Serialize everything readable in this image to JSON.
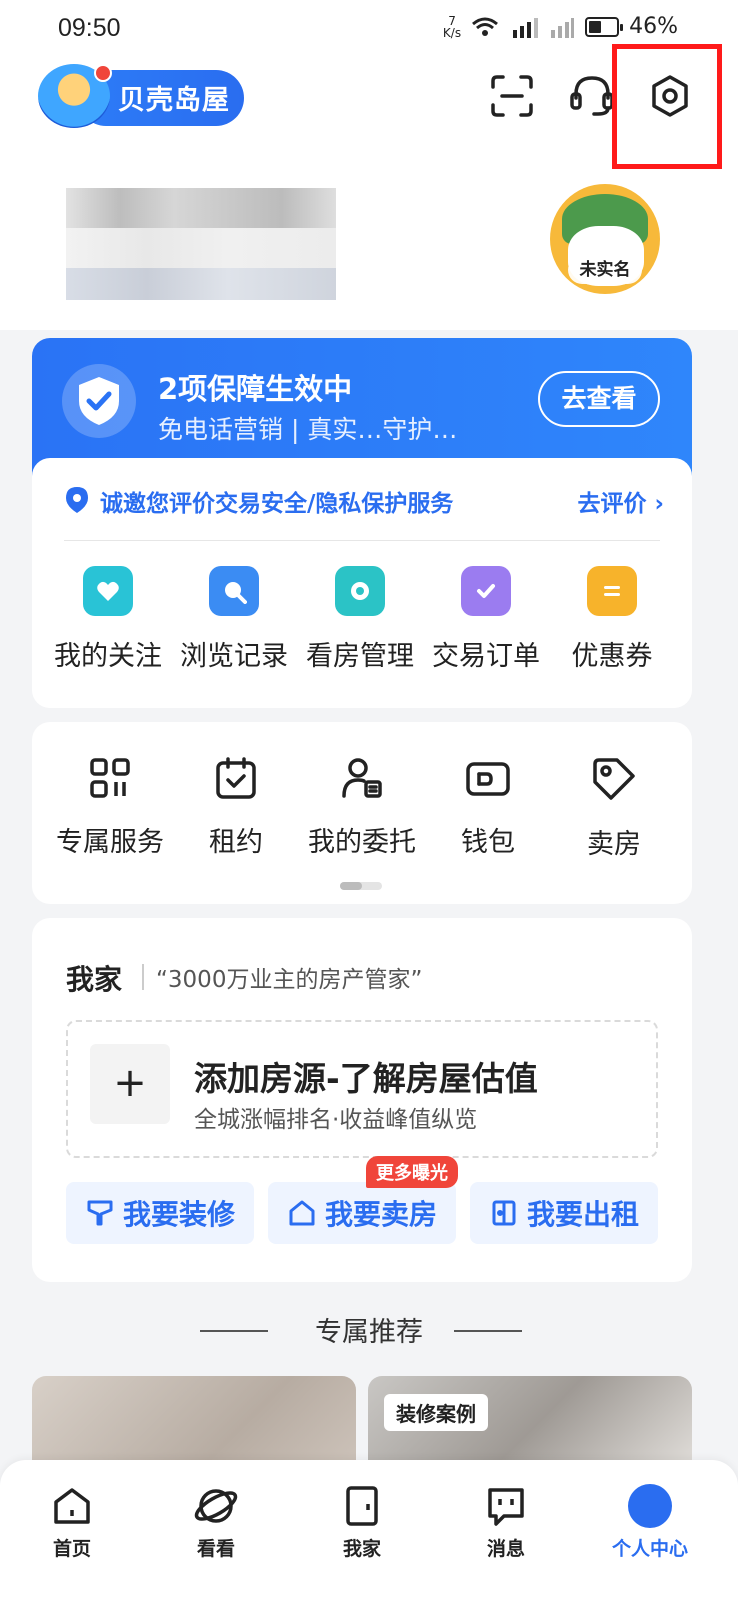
{
  "status_bar": {
    "time": "09:50",
    "net_speed_value": "7",
    "net_speed_unit": "K/s",
    "battery": "46%"
  },
  "header": {
    "logo_text": "贝壳岛屋"
  },
  "profile": {
    "avatar_tag": "未实名"
  },
  "protection": {
    "title": "2项保障生效中",
    "subtitle": "免电话营销 | 真实…守护…",
    "button": "去查看",
    "eval_text": "诚邀您评价交易安全/隐私保护服务",
    "eval_action": "去评价",
    "quick_items": [
      {
        "label": "我的关注",
        "icon": "heart-house-icon",
        "color": "#29c3d6"
      },
      {
        "label": "浏览记录",
        "icon": "search-icon",
        "color": "#3b8cf3"
      },
      {
        "label": "看房管理",
        "icon": "folder-icon",
        "color": "#2bc3c6"
      },
      {
        "label": "交易订单",
        "icon": "clipboard-check-icon",
        "color": "#9b7cf0"
      },
      {
        "label": "优惠券",
        "icon": "coupon-icon",
        "color": "#f7b32b"
      }
    ]
  },
  "tools": {
    "items": [
      {
        "label": "专属服务",
        "icon": "grid-apps-icon"
      },
      {
        "label": "租约",
        "icon": "calendar-check-icon"
      },
      {
        "label": "我的委托",
        "icon": "user-doc-icon"
      },
      {
        "label": "钱包",
        "icon": "wallet-icon"
      },
      {
        "label": "卖房",
        "icon": "price-tag-icon"
      }
    ]
  },
  "home": {
    "title": "我家",
    "subtitle": "“3000万业主的房产管家”",
    "add_title": "添加房源-了解房屋估值",
    "add_subtitle": "全城涨幅排名·收益峰值纵览",
    "add_plus": "+",
    "buttons": [
      {
        "label": "我要装修",
        "icon": "paint-brush-icon"
      },
      {
        "label": "我要卖房",
        "icon": "house-icon"
      },
      {
        "label": "我要出租",
        "icon": "door-icon"
      }
    ],
    "badge": "更多曝光"
  },
  "recommend": {
    "title": "专属推荐",
    "card_tag": "装修案例"
  },
  "tabbar": {
    "tabs": [
      {
        "label": "首页",
        "icon": "home-icon"
      },
      {
        "label": "看看",
        "icon": "planet-icon"
      },
      {
        "label": "我家",
        "icon": "door-icon"
      },
      {
        "label": "消息",
        "icon": "chat-icon"
      },
      {
        "label": "个人中心",
        "icon": "profile-icon"
      }
    ],
    "active_color": "#2a6df0"
  },
  "colors": {
    "brand_blue": "#2a6df0",
    "highlight_red": "#ff1a1a",
    "badge_red": "#f0453a"
  }
}
